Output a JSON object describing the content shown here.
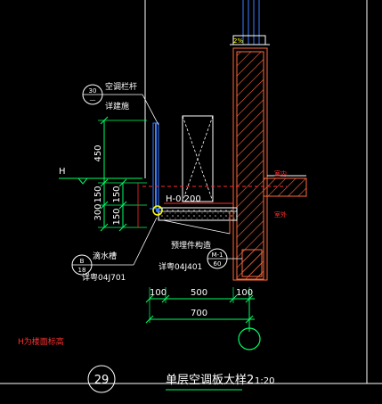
{
  "labels": {
    "railing": "空调栏杆",
    "railing_ref": "详建施",
    "railing_circle_top": "30",
    "railing_circle_bottom": "—",
    "h_mark": "H",
    "elev": "H-0.200",
    "drain": "滴水槽",
    "drain_circle_top": "B",
    "drain_circle_bottom": "18",
    "drain_ref": "详粤04J701",
    "embed": "预埋件构造",
    "embed_ref": "详粤04J401",
    "embed_circle_top": "M-1",
    "embed_circle_bottom": "60",
    "room_top": "室内",
    "room_bottom": "室外",
    "slope": "2%",
    "note": "H为楼面标高",
    "detail_no": "29",
    "title": "单层空调板大样2",
    "scale": "1:20"
  },
  "dims": {
    "v_450": "450",
    "v_150a": "150",
    "v_300": "300",
    "v_150b": "150",
    "v_150c": "150",
    "h_100a": "100",
    "h_500": "500",
    "h_100b": "100",
    "h_700": "700"
  },
  "colors": {
    "background": "#000000",
    "wall_hatch": "#ff6a3c",
    "text": "#ffffff",
    "dim": "#00ff66",
    "red": "#ff2a2a",
    "blue": "#3a7bff",
    "yellow": "#ffff00"
  }
}
